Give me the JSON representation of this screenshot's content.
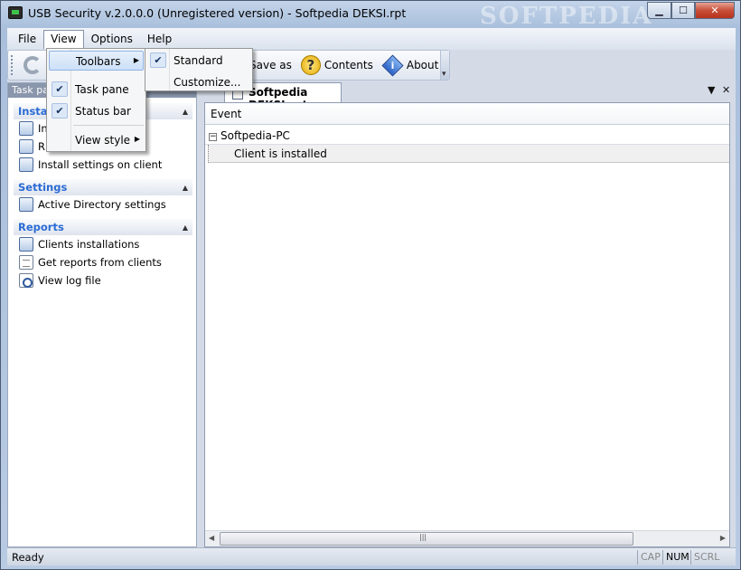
{
  "window": {
    "title": "USB Security v.2.0.0.0 (Unregistered version) - Softpedia DEKSI.rpt",
    "watermark": "SOFTPEDIA",
    "minimize_label": "▁",
    "maximize_label": "☐",
    "close_label": "✕"
  },
  "menubar": {
    "items": [
      {
        "label": "File"
      },
      {
        "label": "View"
      },
      {
        "label": "Options"
      },
      {
        "label": "Help"
      }
    ]
  },
  "toolbar": {
    "save_as_label": "Save as",
    "contents_label": "Contents",
    "about_label": "About"
  },
  "view_menu": {
    "items": [
      {
        "label": "Toolbars",
        "checked": false,
        "submenu": true
      },
      {
        "label": "Task pane",
        "checked": true
      },
      {
        "label": "Status bar",
        "checked": true
      },
      {
        "label": "View style",
        "submenu": true
      }
    ]
  },
  "toolbars_submenu": {
    "items": [
      {
        "label": "Standard",
        "checked": true
      },
      {
        "label": "Customize..."
      }
    ]
  },
  "taskpane": {
    "header": "Task pa",
    "sections": [
      {
        "title": "Install",
        "items": [
          {
            "label": "In",
            "icon": "install-icon"
          },
          {
            "label": "R",
            "icon": "remove-icon"
          },
          {
            "label": "Install settings on client",
            "icon": "install-settings-icon"
          }
        ]
      },
      {
        "title": "Settings",
        "items": [
          {
            "label": "Active Directory settings",
            "icon": "active-directory-icon"
          }
        ]
      },
      {
        "title": "Reports",
        "items": [
          {
            "label": "Clients installations",
            "icon": "clients-icon"
          },
          {
            "label": "Get reports from clients",
            "icon": "report-icon"
          },
          {
            "label": "View log file",
            "icon": "log-search-icon"
          }
        ]
      }
    ]
  },
  "document": {
    "tab_label": "Softpedia DEKSI.rpt",
    "column_header": "Event",
    "tree_root": "Softpedia-PC",
    "tree_child": "Client is installed"
  },
  "statusbar": {
    "text": "Ready",
    "cap": "CAP",
    "num": "NUM",
    "scrl": "SCRL"
  }
}
